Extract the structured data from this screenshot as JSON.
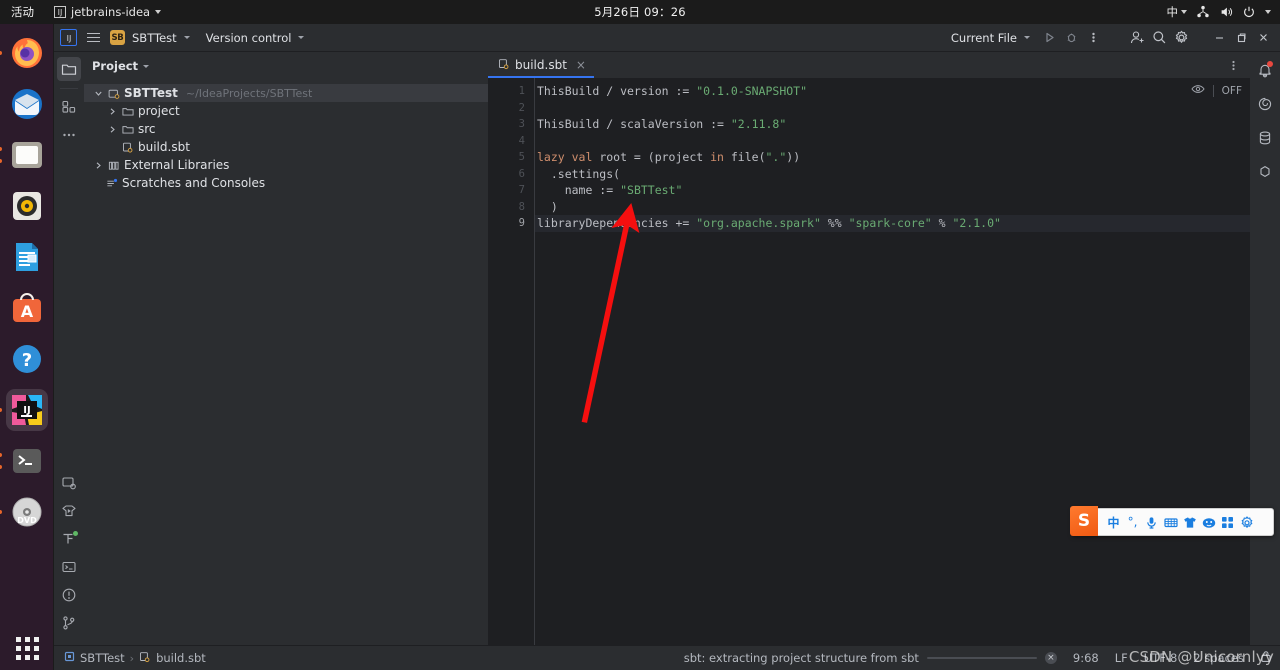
{
  "desktop": {
    "activities_label": "活动",
    "app_menu_label": "jetbrains-idea",
    "clock": "5月26日  09：26",
    "ime_label": "中",
    "dock_items": [
      {
        "name": "firefox",
        "label": "Firefox"
      },
      {
        "name": "thunderbird",
        "label": "Thunderbird Mail"
      },
      {
        "name": "files",
        "label": "Files"
      },
      {
        "name": "rhythmbox",
        "label": "Rhythmbox"
      },
      {
        "name": "libreoffice-writer",
        "label": "LibreOffice Writer"
      },
      {
        "name": "ubuntu-software",
        "label": "Ubuntu Software"
      },
      {
        "name": "help",
        "label": "Help"
      },
      {
        "name": "intellij-idea",
        "label": "IntelliJ IDEA"
      },
      {
        "name": "terminal",
        "label": "Terminal"
      },
      {
        "name": "dvd",
        "label": "DVD"
      }
    ],
    "show_apps_label": "Show Applications"
  },
  "toolbar": {
    "project_badge": "SB",
    "project_name": "SBTTest",
    "version_control_label": "Version control",
    "run_config_label": "Current File",
    "run_label": "Run",
    "debug_label": "Debug",
    "more_label": "More Actions",
    "account_label": "Account",
    "search_label": "Search Everywhere",
    "settings_label": "Settings",
    "minimize_label": "Minimize",
    "maximize_label": "Maximize",
    "close_label": "Close"
  },
  "tool_rail": {
    "items": [
      {
        "name": "project",
        "label": "Project",
        "selected": true
      },
      {
        "name": "commit",
        "label": "Commit",
        "selected": false
      },
      {
        "name": "more-tool-windows",
        "label": "More Tool Windows",
        "selected": false
      }
    ],
    "bottom_items": [
      {
        "name": "sbt",
        "label": "sbt"
      },
      {
        "name": "run",
        "label": "Run"
      },
      {
        "name": "structure",
        "label": "Structure"
      },
      {
        "name": "terminal",
        "label": "Terminal"
      },
      {
        "name": "problems",
        "label": "Problems"
      },
      {
        "name": "version-control",
        "label": "Version Control"
      }
    ]
  },
  "project_panel": {
    "title": "Project",
    "tree": [
      {
        "name": "SBTTest",
        "sub": "~/IdeaProjects/SBTTest",
        "indent": 0,
        "arrow": "down",
        "icon": "module-icon",
        "bold": true,
        "selected": true
      },
      {
        "name": "project",
        "sub": "",
        "indent": 1,
        "arrow": "right",
        "icon": "folder-icon",
        "bold": false,
        "selected": false
      },
      {
        "name": "src",
        "sub": "",
        "indent": 1,
        "arrow": "right",
        "icon": "folder-icon",
        "bold": false,
        "selected": false
      },
      {
        "name": "build.sbt",
        "sub": "",
        "indent": 2,
        "arrow": "none",
        "icon": "sbt-file-icon",
        "bold": false,
        "selected": false
      },
      {
        "name": "External Libraries",
        "sub": "",
        "indent": 0,
        "arrow": "right",
        "icon": "library-icon",
        "bold": false,
        "selected": false
      },
      {
        "name": "Scratches and Consoles",
        "sub": "",
        "indent": 0,
        "arrow": "none",
        "icon": "scratches-icon",
        "bold": false,
        "selected": false
      }
    ]
  },
  "editor": {
    "tab_label": "build.sbt",
    "tab_close": "×",
    "inspection_state": "OFF",
    "lines": [
      {
        "num": "1",
        "current": false,
        "tokens": [
          {
            "t": "ThisBuild / version := ",
            "c": "p"
          },
          {
            "t": "\"0.1.0-SNAPSHOT\"",
            "c": "s"
          }
        ]
      },
      {
        "num": "2",
        "current": false,
        "tokens": [
          {
            "t": "",
            "c": "p"
          }
        ]
      },
      {
        "num": "3",
        "current": false,
        "tokens": [
          {
            "t": "ThisBuild / scalaVersion := ",
            "c": "p"
          },
          {
            "t": "\"2.11.8\"",
            "c": "s"
          }
        ]
      },
      {
        "num": "4",
        "current": false,
        "tokens": [
          {
            "t": "",
            "c": "p"
          }
        ]
      },
      {
        "num": "5",
        "current": false,
        "tokens": [
          {
            "t": "lazy val ",
            "c": "k"
          },
          {
            "t": "root = (project ",
            "c": "p"
          },
          {
            "t": "in ",
            "c": "k"
          },
          {
            "t": "file(",
            "c": "p"
          },
          {
            "t": "\".\"",
            "c": "s"
          },
          {
            "t": "))",
            "c": "p"
          }
        ]
      },
      {
        "num": "6",
        "current": false,
        "tokens": [
          {
            "t": "  .settings(",
            "c": "p"
          }
        ]
      },
      {
        "num": "7",
        "current": false,
        "tokens": [
          {
            "t": "    name := ",
            "c": "p"
          },
          {
            "t": "\"SBTTest\"",
            "c": "s"
          }
        ]
      },
      {
        "num": "8",
        "current": false,
        "tokens": [
          {
            "t": "  )",
            "c": "p"
          }
        ]
      },
      {
        "num": "9",
        "current": true,
        "tokens": [
          {
            "t": "libraryDependencies += ",
            "c": "p"
          },
          {
            "t": "\"org.apache.spark\"",
            "c": "s"
          },
          {
            "t": " %% ",
            "c": "p"
          },
          {
            "t": "\"spark-core\"",
            "c": "s"
          },
          {
            "t": " % ",
            "c": "p"
          },
          {
            "t": "\"2.1.0\"",
            "c": "s"
          }
        ]
      }
    ]
  },
  "right_rail": {
    "items": [
      {
        "name": "notifications",
        "label": "Notifications",
        "badge": true
      },
      {
        "name": "scala",
        "label": "Scala",
        "badge": false
      },
      {
        "name": "database",
        "label": "Database",
        "badge": false
      },
      {
        "name": "maven",
        "label": "Maven",
        "badge": false
      }
    ]
  },
  "status_bar": {
    "breadcrumb_project": "SBTTest",
    "breadcrumb_sep": "›",
    "breadcrumb_file": "build.sbt",
    "progress_text": "sbt: extracting project structure from sbt",
    "progress_cancel": "×",
    "caret_position": "9:68",
    "line_separator": "LF",
    "encoding": "UTF-8",
    "indent": "2 spaces",
    "lock_label": "Read-only toggle"
  },
  "ime": {
    "logo": "S",
    "items": [
      {
        "name": "chinese-mode",
        "label": "中"
      },
      {
        "name": "punctuation",
        "label": "°,"
      },
      {
        "name": "voice-input",
        "label": "🎤"
      },
      {
        "name": "soft-keyboard",
        "label": "⌨"
      },
      {
        "name": "skin",
        "label": "👕"
      },
      {
        "name": "emoji",
        "label": "☺"
      },
      {
        "name": "app-grid",
        "label": "▦"
      },
      {
        "name": "settings",
        "label": "✿"
      }
    ]
  },
  "watermark": {
    "text": "CSDN @Unicornlyy"
  }
}
